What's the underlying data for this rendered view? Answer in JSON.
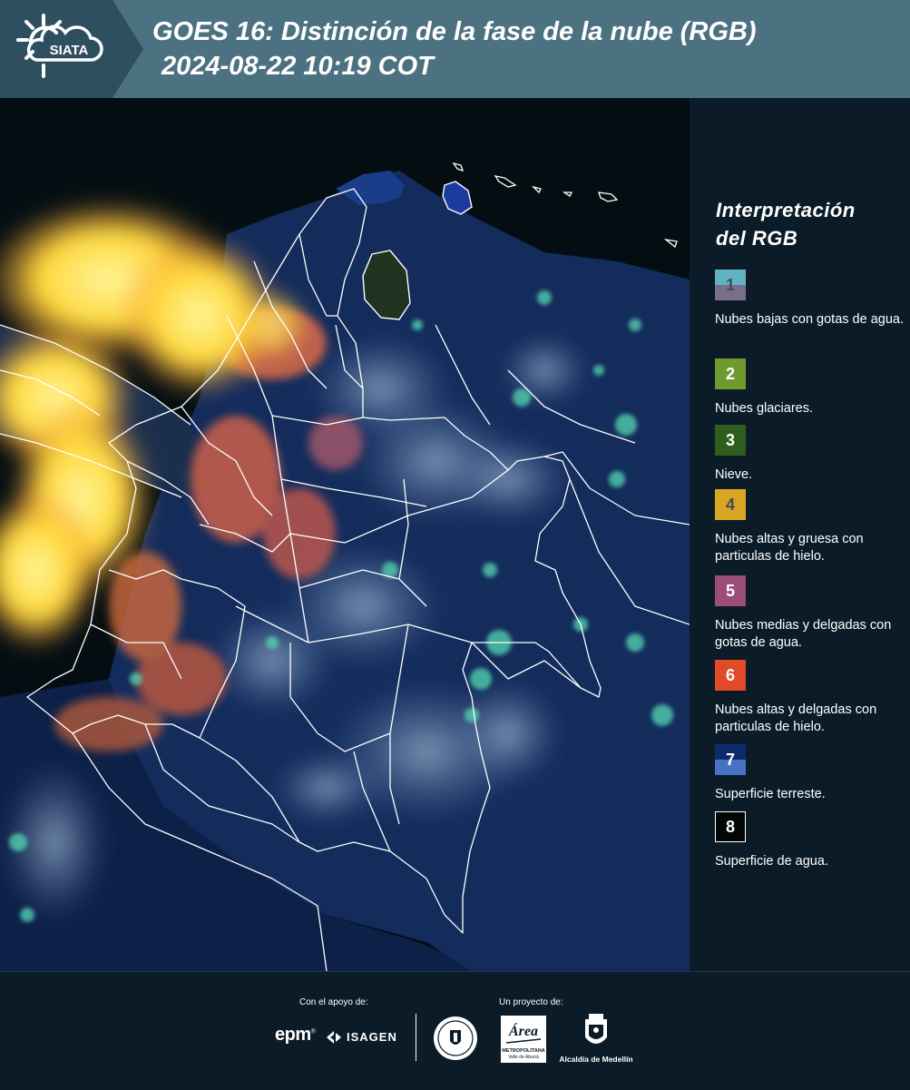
{
  "header": {
    "logo_text": "SIATA",
    "title": "GOES 16: Distinción de la fase de la nube (RGB)",
    "datetime": "2024-08-22 10:19 COT"
  },
  "legend": {
    "title_line1": "Interpretación",
    "title_line2": "del RGB",
    "items": [
      {
        "number": "1",
        "label": "Nubes bajas con gotas de agua.",
        "color_top": "#62b3c1",
        "color_bottom": "#7b6e8a",
        "text_color": "#4a4a55"
      },
      {
        "number": "2",
        "label": "Nubes glaciares.",
        "color_top": "#6f9a2e",
        "color_bottom": "#6f9a2e",
        "text_color": "#ffffff"
      },
      {
        "number": "3",
        "label": "Nieve.",
        "color_top": "#2f5e1c",
        "color_bottom": "#2f5e1c",
        "text_color": "#ffffff"
      },
      {
        "number": "4",
        "label": "Nubes altas y gruesa con particulas de hielo.",
        "color_top": "#d8a623",
        "color_bottom": "#d8a623",
        "text_color": "#4a4a55"
      },
      {
        "number": "5",
        "label": "Nubes medias y delgadas con gotas de agua.",
        "color_top": "#9a4d78",
        "color_bottom": "#9a4d78",
        "text_color": "#ffffff"
      },
      {
        "number": "6",
        "label": "Nubes altas y delgadas con particulas de hielo.",
        "color_top": "#e04a28",
        "color_bottom": "#e04a28",
        "text_color": "#ffffff"
      },
      {
        "number": "7",
        "label": "Superficie terreste.",
        "color_top": "#0f2a6a",
        "color_bottom": "#4a72c4",
        "text_color": "#ffffff"
      },
      {
        "number": "8",
        "label": "Superficie de agua.",
        "color_top": "#020604",
        "color_bottom": "#020604",
        "text_color": "#ffffff"
      }
    ]
  },
  "footer": {
    "support_label": "Con el apoyo de:",
    "project_label": "Un proyecto de:",
    "epm": "epm",
    "epm_mark": "®",
    "isagen": "ISAGEN",
    "area_text1": "Área",
    "area_text2": "METROPOLITANA",
    "area_text3": "Valle de Aburrá",
    "alcaldia": "Alcaldía de Medellín"
  },
  "colors": {
    "header_bg": "#4c7282",
    "panel_bg": "#0b1c28",
    "land": "#142c5a",
    "water": "#030d0f",
    "cloud_ice": "#ffe34a",
    "cloud_thin": "#e8734a",
    "cloud_low": "#8fb6c8",
    "cloud_glacial": "#5cd6b0"
  }
}
